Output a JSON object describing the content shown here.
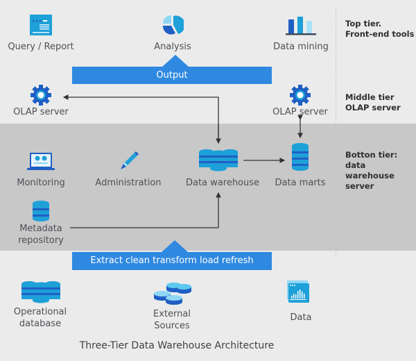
{
  "title": "Three-Tier Data Warehouse Architecture",
  "tiers": {
    "top": [
      "Top tier.",
      "Front-end tools"
    ],
    "middle": [
      "Middle tier",
      "OLAP server"
    ],
    "bottom": [
      "Botton tier:",
      "data warehouse",
      "server"
    ]
  },
  "top_tools": {
    "query_report": "Query / Report",
    "analysis": "Analysis",
    "data_mining": "Data mining"
  },
  "output_banner": "Output",
  "middle": {
    "olap_left": "OLAP server",
    "olap_right": "OLAP server"
  },
  "bottom": {
    "monitoring": "Monitoring",
    "administration": "Administration",
    "data_warehouse": "Data warehouse",
    "data_marts": "Data marts",
    "metadata": [
      "Metadata",
      "repository"
    ]
  },
  "etl_banner": "Extract clean transform load refresh",
  "sources": {
    "operational": [
      "Operational",
      "database"
    ],
    "external": [
      "External",
      "Sources"
    ],
    "data": "Data"
  },
  "colors": {
    "accent": "#2f89e0",
    "dark_blue": "#1f5fc4",
    "mid_blue": "#1ea0d8",
    "light_blue": "#8fd6f5",
    "band": "#c8c8c8",
    "background": "#ebebeb"
  }
}
